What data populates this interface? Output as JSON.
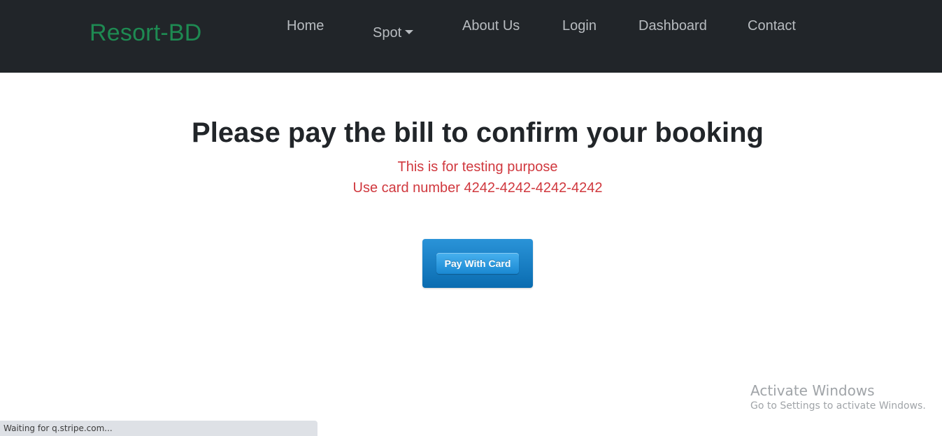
{
  "navbar": {
    "brand": "Resort-BD",
    "items": [
      {
        "label": "Home"
      },
      {
        "label": "Spot",
        "dropdown": true
      },
      {
        "label": "About Us"
      },
      {
        "label": "Login"
      },
      {
        "label": "Dashboard"
      },
      {
        "label": "Contact"
      }
    ]
  },
  "main": {
    "title": "Please pay the bill to confirm your booking",
    "note_line1": "This is for testing purpose",
    "note_line2": "Use card number 4242-4242-4242-4242",
    "pay_button_label": "Pay With Card"
  },
  "overlay": {
    "watermark_title": "Activate Windows",
    "watermark_subtitle": "Go to Settings to activate Windows.",
    "status_text": "Waiting for q.stripe.com..."
  },
  "colors": {
    "navbar_bg": "#212529",
    "brand": "#1e8a52",
    "note_text": "#d0383e",
    "pay_button": "#0a6cb0"
  }
}
